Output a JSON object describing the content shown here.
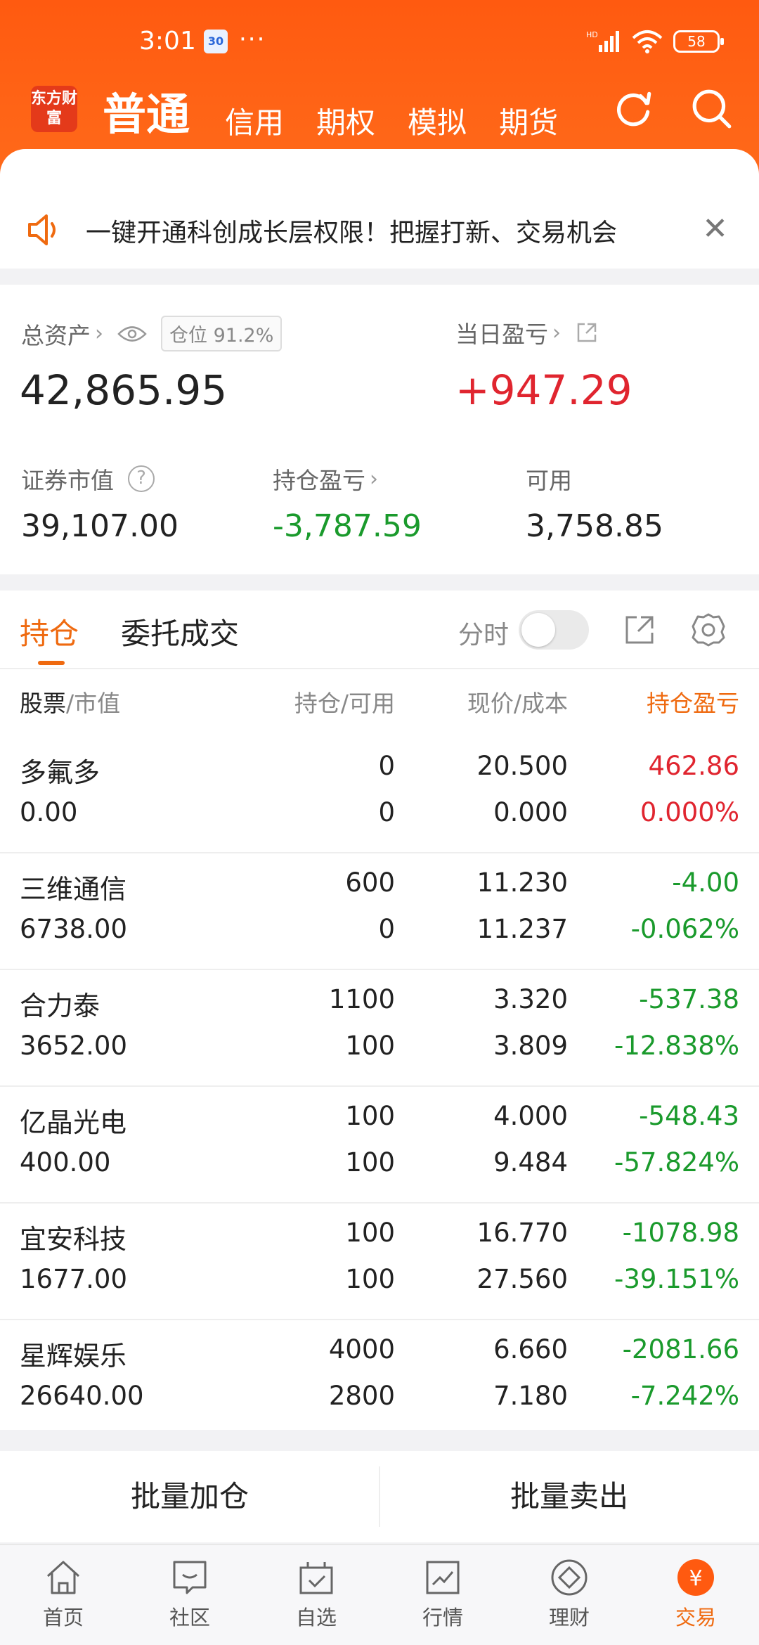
{
  "status": {
    "time": "3:01",
    "notif_badge": "30",
    "dots": "···",
    "network": "HD",
    "battery": "58"
  },
  "header": {
    "logo": "东方财富",
    "tabs": [
      "普通",
      "信用",
      "期权",
      "模拟",
      "期货"
    ],
    "active_tab": "普通"
  },
  "notice": {
    "text": "一键开通科创成长层权限！把握打新、交易机会"
  },
  "assets": {
    "total_label": "总资产",
    "position_badge": "仓位  91.2%",
    "total_value": "42,865.95",
    "daily_label": "当日盈亏",
    "daily_value": "+947.29",
    "securities_label": "证券市值",
    "securities_value": "39,107.00",
    "holding_pl_label": "持仓盈亏",
    "holding_pl_value": "-3,787.59",
    "available_label": "可用",
    "available_value": "3,758.85"
  },
  "holdings": {
    "tab_positions": "持仓",
    "tab_orders": "委托成交",
    "fenshi_label": "分时",
    "columns": {
      "stock": "股票",
      "mv": "/市值",
      "hold": "持仓/可用",
      "price": "现价/成本",
      "pl": "持仓盈亏"
    },
    "rows": [
      {
        "name": "多氟多",
        "mv": "0.00",
        "hold": "0",
        "avail": "0",
        "price": "20.500",
        "cost": "0.000",
        "pl": "462.86",
        "plp": "0.000%",
        "dir": "up"
      },
      {
        "name": "三维通信",
        "mv": "6738.00",
        "hold": "600",
        "avail": "0",
        "price": "11.230",
        "cost": "11.237",
        "pl": "-4.00",
        "plp": "-0.062%",
        "dir": "down"
      },
      {
        "name": "合力泰",
        "mv": "3652.00",
        "hold": "1100",
        "avail": "100",
        "price": "3.320",
        "cost": "3.809",
        "pl": "-537.38",
        "plp": "-12.838%",
        "dir": "down"
      },
      {
        "name": "亿晶光电",
        "mv": "400.00",
        "hold": "100",
        "avail": "100",
        "price": "4.000",
        "cost": "9.484",
        "pl": "-548.43",
        "plp": "-57.824%",
        "dir": "down"
      },
      {
        "name": "宜安科技",
        "mv": "1677.00",
        "hold": "100",
        "avail": "100",
        "price": "16.770",
        "cost": "27.560",
        "pl": "-1078.98",
        "plp": "-39.151%",
        "dir": "down"
      },
      {
        "name": "星辉娱乐",
        "mv": "26640.00",
        "hold": "4000",
        "avail": "2800",
        "price": "6.660",
        "cost": "7.180",
        "pl": "-2081.66",
        "plp": "-7.242%",
        "dir": "down"
      }
    ]
  },
  "batch": {
    "add": "批量加仓",
    "sell": "批量卖出"
  },
  "bottom_nav": [
    {
      "label": "首页",
      "icon": "home-icon"
    },
    {
      "label": "社区",
      "icon": "chat-icon"
    },
    {
      "label": "自选",
      "icon": "watchlist-icon"
    },
    {
      "label": "行情",
      "icon": "market-icon"
    },
    {
      "label": "理财",
      "icon": "wealth-icon"
    },
    {
      "label": "交易",
      "icon": "trade-icon"
    }
  ],
  "colors": {
    "brand": "#ff5a10",
    "accent": "#ef6a10",
    "up": "#e0252f",
    "down": "#1a9a2c"
  }
}
